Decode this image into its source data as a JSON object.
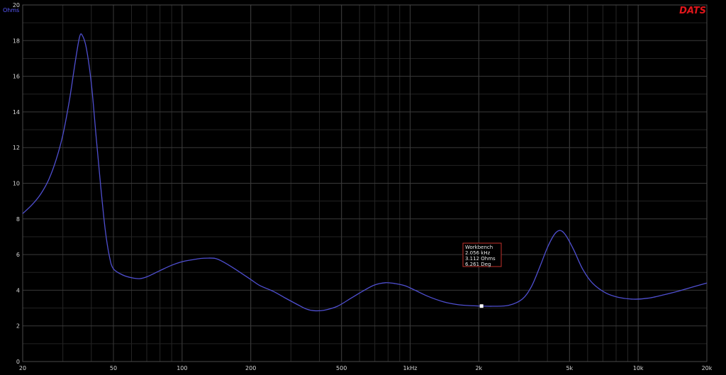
{
  "chart_data": {
    "type": "line",
    "title": "",
    "xlabel": "",
    "ylabel": "Ohms",
    "x_scale": "log",
    "xlim": [
      20,
      20000
    ],
    "ylim": [
      0,
      20
    ],
    "grid": true,
    "brand": "DATS",
    "x_ticks": [
      {
        "value": 20,
        "label": "20"
      },
      {
        "value": 50,
        "label": "50"
      },
      {
        "value": 100,
        "label": "100"
      },
      {
        "value": 200,
        "label": "200"
      },
      {
        "value": 500,
        "label": "500"
      },
      {
        "value": 1000,
        "label": "1kHz"
      },
      {
        "value": 2000,
        "label": "2k"
      },
      {
        "value": 5000,
        "label": "5k"
      },
      {
        "value": 10000,
        "label": "10k"
      },
      {
        "value": 20000,
        "label": "20k"
      }
    ],
    "y_ticks": [
      0,
      2,
      4,
      6,
      8,
      10,
      12,
      14,
      16,
      18,
      20
    ],
    "colors": {
      "background": "#000000",
      "grid": "#3a3a3a",
      "curve": "#4f4fd0",
      "tick_text": "#d8d8d8",
      "ylabel": "#5a5aff",
      "brand": "#e0161b",
      "cursor_box_border": "#c0302a"
    },
    "series": [
      {
        "name": "",
        "points": [
          [
            20,
            8.3
          ],
          [
            22,
            8.8
          ],
          [
            24,
            9.4
          ],
          [
            26,
            10.2
          ],
          [
            28,
            11.3
          ],
          [
            30,
            12.7
          ],
          [
            32,
            14.6
          ],
          [
            34,
            16.8
          ],
          [
            35.5,
            18.2
          ],
          [
            36.5,
            18.3
          ],
          [
            38,
            17.6
          ],
          [
            40,
            15.6
          ],
          [
            42,
            12.6
          ],
          [
            44,
            9.8
          ],
          [
            46,
            7.4
          ],
          [
            48,
            5.9
          ],
          [
            50,
            5.2
          ],
          [
            55,
            4.85
          ],
          [
            60,
            4.7
          ],
          [
            65,
            4.65
          ],
          [
            70,
            4.75
          ],
          [
            80,
            5.1
          ],
          [
            90,
            5.4
          ],
          [
            100,
            5.6
          ],
          [
            110,
            5.7
          ],
          [
            120,
            5.78
          ],
          [
            130,
            5.8
          ],
          [
            140,
            5.78
          ],
          [
            150,
            5.62
          ],
          [
            170,
            5.2
          ],
          [
            200,
            4.6
          ],
          [
            220,
            4.25
          ],
          [
            250,
            3.95
          ],
          [
            280,
            3.6
          ],
          [
            320,
            3.2
          ],
          [
            350,
            2.95
          ],
          [
            380,
            2.85
          ],
          [
            420,
            2.88
          ],
          [
            480,
            3.1
          ],
          [
            550,
            3.55
          ],
          [
            620,
            3.95
          ],
          [
            700,
            4.3
          ],
          [
            780,
            4.42
          ],
          [
            850,
            4.38
          ],
          [
            950,
            4.25
          ],
          [
            1050,
            4.0
          ],
          [
            1200,
            3.65
          ],
          [
            1400,
            3.35
          ],
          [
            1600,
            3.2
          ],
          [
            1800,
            3.14
          ],
          [
            2056,
            3.112
          ],
          [
            2300,
            3.1
          ],
          [
            2700,
            3.15
          ],
          [
            3100,
            3.5
          ],
          [
            3400,
            4.2
          ],
          [
            3700,
            5.3
          ],
          [
            4000,
            6.4
          ],
          [
            4300,
            7.15
          ],
          [
            4550,
            7.35
          ],
          [
            4800,
            7.1
          ],
          [
            5200,
            6.3
          ],
          [
            5700,
            5.2
          ],
          [
            6300,
            4.4
          ],
          [
            7200,
            3.85
          ],
          [
            8200,
            3.6
          ],
          [
            9500,
            3.5
          ],
          [
            11000,
            3.55
          ],
          [
            13000,
            3.75
          ],
          [
            15000,
            3.95
          ],
          [
            17000,
            4.15
          ],
          [
            20000,
            4.4
          ]
        ]
      }
    ],
    "cursor": {
      "x": 2056,
      "y": 3.112,
      "lines": [
        "Workbench",
        "2.056 kHz",
        "3.112 Ohms",
        "6.261 Deg"
      ]
    }
  }
}
